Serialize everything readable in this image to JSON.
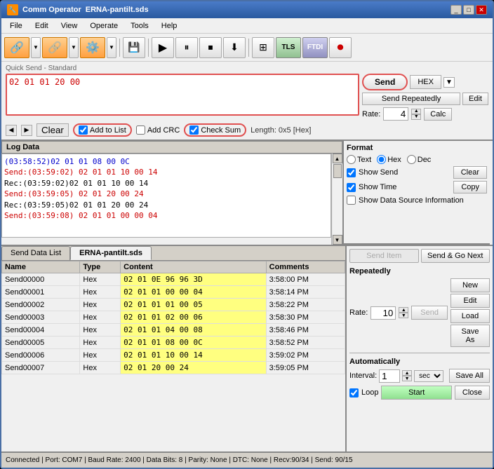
{
  "window": {
    "title": "Comm Operator",
    "subtitle": "ERNA-pantilt.sds"
  },
  "menu": {
    "items": [
      "File",
      "Edit",
      "View",
      "Operate",
      "Tools",
      "Help"
    ]
  },
  "quick_send": {
    "label": "Quick Send - Standard",
    "input_value": "02 01 01 20 00",
    "send_button": "Send",
    "hex_label": "HEX",
    "send_repeatedly_label": "Send Repeatedly",
    "edit_label": "Edit",
    "rate_label": "Rate:",
    "rate_value": "4",
    "calc_label": "Calc",
    "clear_label": "Clear",
    "add_to_list_label": "Add to List",
    "add_crc_label": "Add CRC",
    "check_sum_label": "Check Sum",
    "length_label": "Length: 0x5 [Hex]"
  },
  "log": {
    "header": "Log Data",
    "lines": [
      {
        "type": "recv",
        "text": "(03:58:52)02 01 01 08 00 0C"
      },
      {
        "type": "send",
        "text": "Send:(03:59:02) 02 01 01 10 00 14"
      },
      {
        "type": "recv",
        "text": "Rec:(03:59:02)02 01 01 10 00 14"
      },
      {
        "type": "send",
        "text": "Send:(03:59:05) 02 01 20 00 24"
      },
      {
        "type": "recv",
        "text": "Rec:(03:59:05)02 01 01 20 00 24"
      },
      {
        "type": "send",
        "text": "Send:(03:59:08) 02 01 01 00 00 04"
      }
    ]
  },
  "format": {
    "header": "Format",
    "text_label": "Text",
    "hex_label": "Hex",
    "dec_label": "Dec",
    "show_send_label": "Show Send",
    "show_time_label": "Show Time",
    "show_data_source_label": "Show Data Source Information",
    "clear_label": "Clear",
    "copy_label": "Copy"
  },
  "tabs": {
    "tab1": "Send Data List",
    "tab2": "ERNA-pantilt.sds"
  },
  "table": {
    "headers": [
      "Name",
      "Type",
      "Content",
      "Comments"
    ],
    "rows": [
      {
        "name": "Send00000",
        "type": "Hex",
        "content": "02 01 0E 96 96 3D",
        "comment": "3:58:00 PM"
      },
      {
        "name": "Send00001",
        "type": "Hex",
        "content": "02 01 01 00 00 04",
        "comment": "3:58:14 PM"
      },
      {
        "name": "Send00002",
        "type": "Hex",
        "content": "02 01 01 01 00 05",
        "comment": "3:58:22 PM"
      },
      {
        "name": "Send00003",
        "type": "Hex",
        "content": "02 01 01 02 00 06",
        "comment": "3:58:30 PM"
      },
      {
        "name": "Send00004",
        "type": "Hex",
        "content": "02 01 01 04 00 08",
        "comment": "3:58:46 PM"
      },
      {
        "name": "Send00005",
        "type": "Hex",
        "content": "02 01 01 08 00 0C",
        "comment": "3:58:52 PM"
      },
      {
        "name": "Send00006",
        "type": "Hex",
        "content": "02 01 01 10 00 14",
        "comment": "3:59:02 PM"
      },
      {
        "name": "Send00007",
        "type": "Hex",
        "content": "02 01 20 00 24",
        "comment": "3:59:05 PM"
      }
    ]
  },
  "right_panel": {
    "send_item_label": "Send Item",
    "send_go_next_label": "Send & Go Next",
    "repeatedly_label": "Repeatedly",
    "rate_label": "Rate:",
    "rate_value": "10",
    "send_label": "Send",
    "new_label": "New",
    "edit_label": "Edit",
    "load_label": "Load",
    "save_as_label": "Save As",
    "automatically_label": "Automatically",
    "interval_label": "Interval:",
    "interval_value": "1",
    "sec_label": "sec",
    "save_all_label": "Save All",
    "loop_label": "Loop",
    "start_label": "Start",
    "close_label": "Close"
  },
  "status_bar": {
    "text": "Connected | Port: COM7 | Baud Rate: 2400 | Data Bits: 8 | Parity: None | DTC: None | Recv:90/34 | Send: 90/15"
  }
}
